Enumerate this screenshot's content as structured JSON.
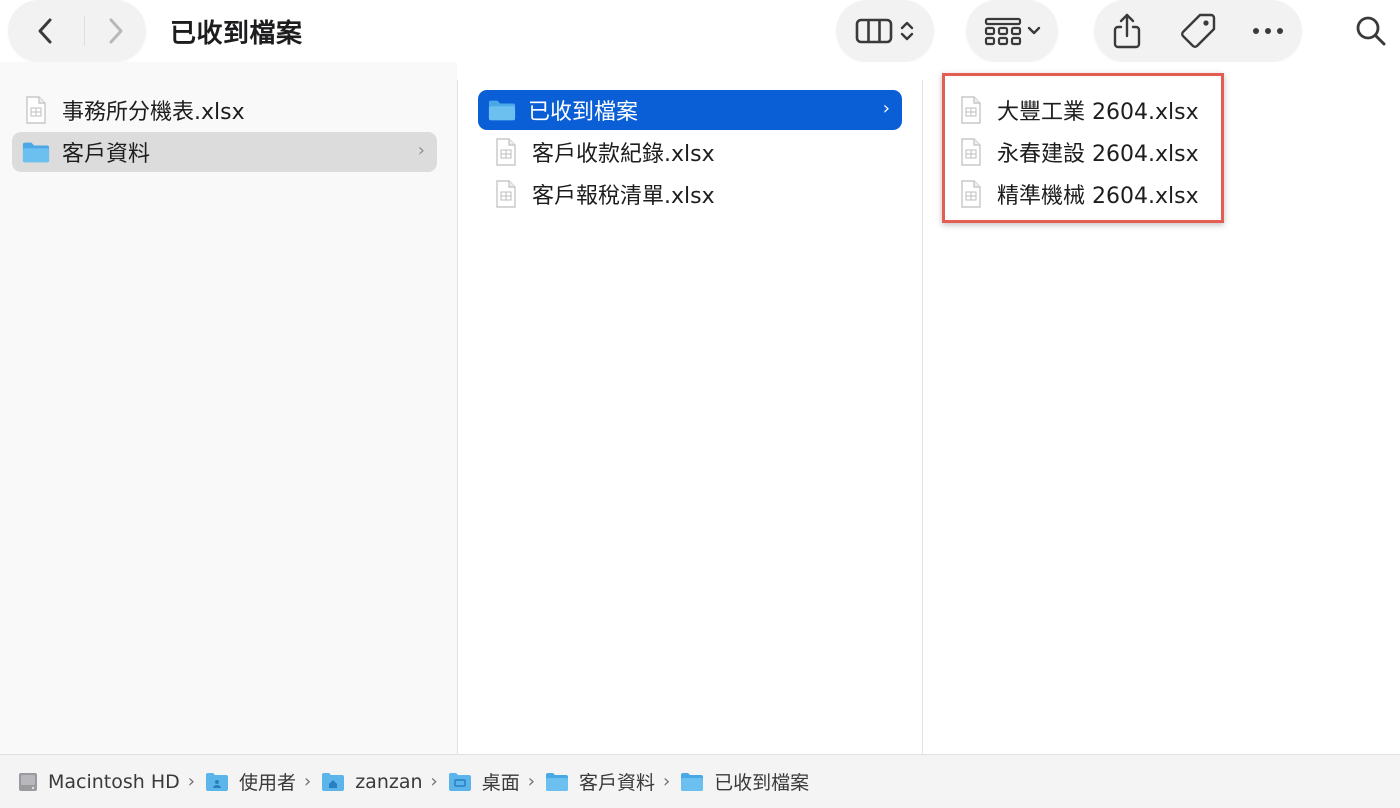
{
  "toolbar": {
    "title": "已收到檔案",
    "buttons": {
      "back": "back-icon",
      "forward": "forward-icon",
      "view": "columns-view-icon",
      "group": "group-grid-icon",
      "share": "share-icon",
      "tag": "tag-icon",
      "more": "more-icon",
      "search": "search-icon"
    }
  },
  "columns": [
    {
      "items": [
        {
          "label": "事務所分機表.xlsx",
          "type": "file"
        },
        {
          "label": "客戶資料",
          "type": "folder",
          "selected": "inactive"
        }
      ]
    },
    {
      "items": [
        {
          "label": "已收到檔案",
          "type": "folder",
          "selected": "active"
        },
        {
          "label": "客戶收款紀錄.xlsx",
          "type": "file"
        },
        {
          "label": "客戶報稅清單.xlsx",
          "type": "file"
        }
      ]
    },
    {
      "items": [
        {
          "label": "大豐工業 2604.xlsx",
          "type": "file"
        },
        {
          "label": "永春建設 2604.xlsx",
          "type": "file"
        },
        {
          "label": "精準機械 2604.xlsx",
          "type": "file"
        }
      ]
    }
  ],
  "pathbar": [
    {
      "label": "Macintosh HD",
      "icon": "hard-drive-icon"
    },
    {
      "label": "使用者",
      "icon": "users-folder-icon"
    },
    {
      "label": "zanzan",
      "icon": "home-folder-icon"
    },
    {
      "label": "桌面",
      "icon": "desktop-folder-icon"
    },
    {
      "label": "客戶資料",
      "icon": "folder-icon"
    },
    {
      "label": "已收到檔案",
      "icon": "folder-icon"
    }
  ],
  "path_separator": "›",
  "row_chevron": "›",
  "colors": {
    "selection_active": "#0a5fd6",
    "selection_inactive": "#dcdcdc",
    "highlight_box": "#e35d52",
    "folder_blue": "#5bb4ea"
  }
}
